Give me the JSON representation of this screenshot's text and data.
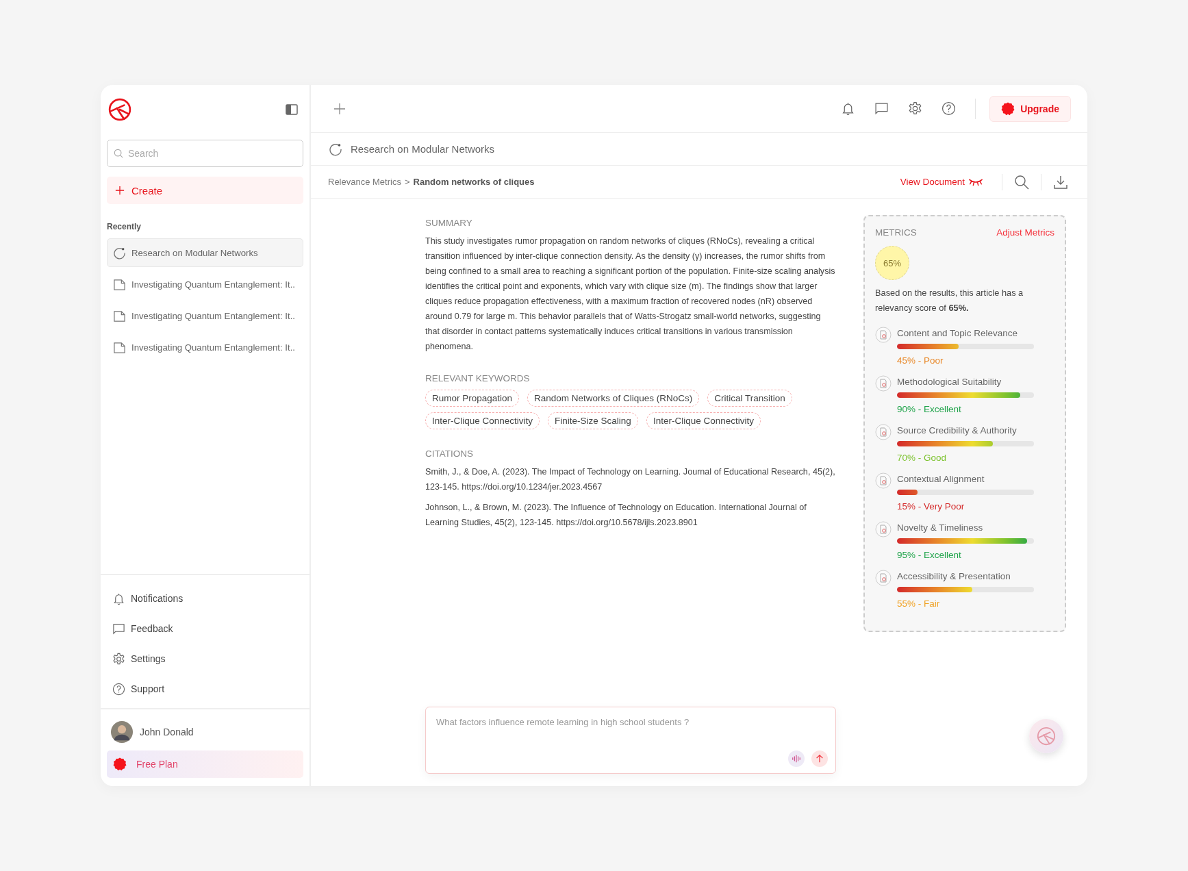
{
  "sidebar": {
    "search": {
      "placeholder": "Search"
    },
    "create_label": "Create",
    "recent_heading": "Recently",
    "recent": [
      {
        "label": "Research on Modular Networks",
        "kind": "research",
        "selected": true
      },
      {
        "label": "Investigating Quantum Entanglement: It..",
        "kind": "document",
        "selected": false
      },
      {
        "label": "Investigating Quantum Entanglement: It..",
        "kind": "document",
        "selected": false
      },
      {
        "label": "Investigating Quantum Entanglement: It..",
        "kind": "document",
        "selected": false
      }
    ],
    "menu": [
      {
        "label": "Notifications",
        "kind": "bell"
      },
      {
        "label": "Feedback",
        "kind": "chat"
      },
      {
        "label": "Settings",
        "kind": "gear"
      },
      {
        "label": "Support",
        "kind": "help"
      }
    ],
    "user": {
      "name": "John Donald"
    },
    "plan": "Free Plan"
  },
  "topbar": {
    "upgrade": "Upgrade"
  },
  "document_title": "Research on Modular Networks",
  "breadcrumb": {
    "parent": "Relevance Metrics",
    "separator": ">",
    "current": "Random networks of cliques"
  },
  "view_document": "View Document",
  "summary": {
    "heading": "SUMMARY",
    "text": "This study investigates rumor propagation on random networks of cliques (RNoCs), revealing a critical transition influenced by inter-clique connection density. As the density (γ) increases, the rumor shifts from being confined to a small area to reaching a significant portion of the population. Finite-size scaling analysis identifies the critical point and exponents, which vary with clique size (m). The findings show that larger cliques reduce propagation effectiveness, with a maximum fraction of recovered nodes (nR) observed around 0.79 for large m. This behavior parallels that of Watts-Strogatz small-world networks, suggesting that disorder in contact patterns systematically induces critical transitions in various transmission phenomena."
  },
  "keywords": {
    "heading": "RELEVANT KEYWORDS",
    "items": [
      "Rumor Propagation",
      "Random Networks of Cliques (RNoCs)",
      "Critical Transition",
      "Inter-Clique Connectivity",
      "Finite-Size Scaling",
      "Inter-Clique Connectivity"
    ]
  },
  "citations": {
    "heading": "CITATIONS",
    "items": [
      "Smith, J., & Doe, A. (2023). The Impact of Technology on Learning. Journal of Educational Research, 45(2), 123-145. https://doi.org/10.1234/jer.2023.4567",
      "Johnson, L., & Brown, M. (2023). The Influence of Technology on Education. International Journal of Learning Studies, 45(2), 123-145. https://doi.org/10.5678/ijls.2023.8901"
    ]
  },
  "metrics": {
    "heading": "METRICS",
    "adjust": "Adjust Metrics",
    "score": "65%",
    "statement": "Based on the results, this article has a relevancy score of **65%.**",
    "items": [
      {
        "label": "Content and Topic Relevance",
        "level": 0.45,
        "reading": "45% - Poor",
        "color": "#e8892a"
      },
      {
        "label": "Methodological Suitability",
        "level": 0.9,
        "reading": "90% - Excellent",
        "color": "#1fa34a"
      },
      {
        "label": "Source Credibility & Authority",
        "level": 0.7,
        "reading": "70% - Good",
        "color": "#7cc22e"
      },
      {
        "label": "Contextual Alignment",
        "level": 0.15,
        "reading": "15% - Very Poor",
        "color": "#d42a2a"
      },
      {
        "label": "Novelty & Timeliness",
        "level": 0.95,
        "reading": "95% - Excellent",
        "color": "#1fa34a"
      },
      {
        "label": "Accessibility & Presentation",
        "level": 0.55,
        "reading": "55% - Fair",
        "color": "#f0a020"
      }
    ]
  },
  "chat": {
    "placeholder": "What factors influence remote learning in high school students ?"
  }
}
